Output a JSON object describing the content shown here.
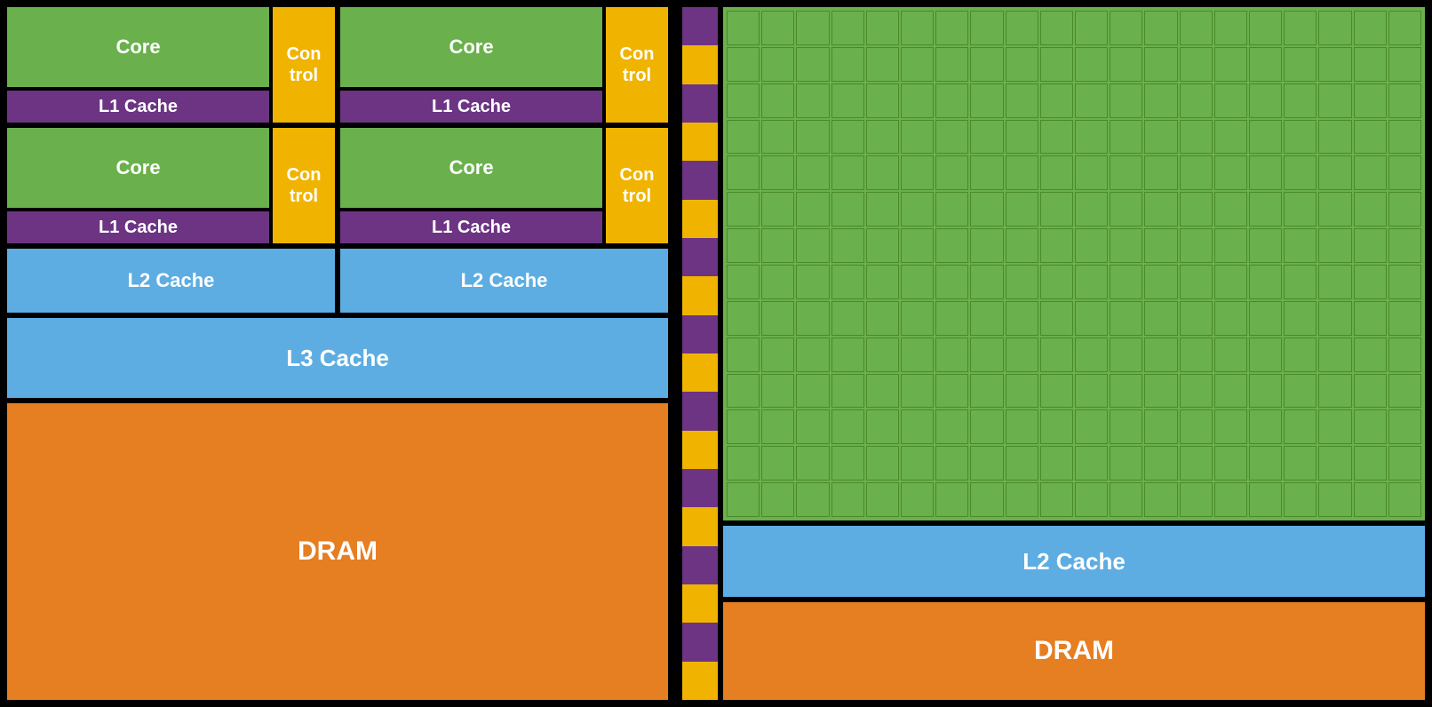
{
  "left": {
    "row1": {
      "cell1": {
        "core": "Core",
        "l1": "L1 Cache",
        "control": "Con\ntrol"
      },
      "cell2": {
        "core": "Core",
        "l1": "L1 Cache",
        "control": "Con\ntrol"
      }
    },
    "row2": {
      "cell1": {
        "core": "Core",
        "l1": "L1 Cache",
        "control": "Con\ntrol"
      },
      "cell2": {
        "core": "Core",
        "l1": "L1 Cache",
        "control": "Con\ntrol"
      }
    },
    "l2_left": "L2 Cache",
    "l2_right": "L2 Cache",
    "l3": "L3 Cache",
    "dram": "DRAM"
  },
  "right": {
    "l2": "L2 Cache",
    "dram": "DRAM",
    "grid_cols": 20,
    "grid_rows": 14
  },
  "colors": {
    "green": "#6ab04c",
    "purple": "#6c3483",
    "gold": "#f0b400",
    "blue": "#5dade2",
    "orange": "#e67e22",
    "black": "#000000"
  }
}
